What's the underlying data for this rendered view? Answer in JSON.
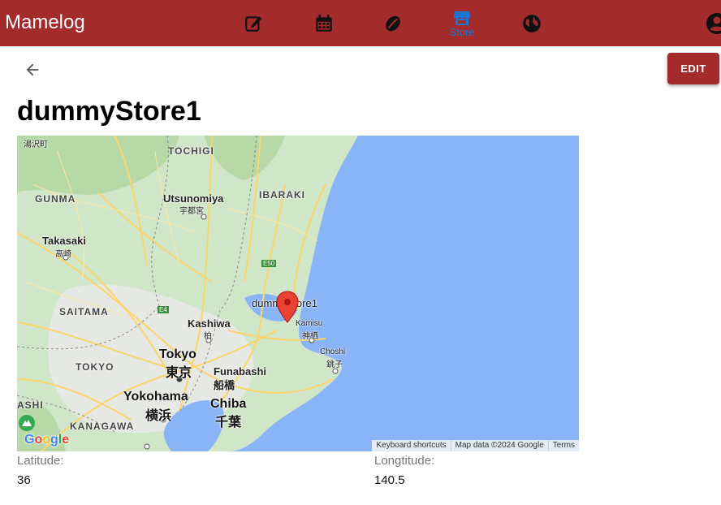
{
  "app": {
    "title": "Mamelog",
    "nav": [
      {
        "icon": "edit-note-icon",
        "label": ""
      },
      {
        "icon": "calendar-icon",
        "label": ""
      },
      {
        "icon": "coffee-bean-icon",
        "label": ""
      },
      {
        "icon": "store-icon",
        "label": "Store",
        "active": true
      },
      {
        "icon": "globe-icon",
        "label": ""
      }
    ],
    "account_icon": "account-circle-icon"
  },
  "toolbar": {
    "back_icon": "arrow-back-icon",
    "edit_label": "EDIT"
  },
  "store": {
    "name": "dummyStore1"
  },
  "map": {
    "marker_label": "dummyStore1",
    "places": {
      "yuzawa": "湯沢町",
      "tochigi": "TOCHIGI",
      "gunma": "GUNMA",
      "ibaraki": "IBARAKI",
      "utsunomiya": "Utsunomiya",
      "utsunomiya_jp": "宇都宮",
      "takasaki": "Takasaki",
      "takasaki_jp": "高崎",
      "e50": "E50",
      "saitama": "SAITAMA",
      "e4": "E4",
      "kashiwa": "Kashiwa",
      "kashiwa_jp": "柏",
      "kamisu": "Kamisu",
      "kamisu_jp": "神栖",
      "choshi": "Choshi",
      "choshi_jp": "銚子",
      "tokyo_region": "TOKYO",
      "tokyo": "Tokyo",
      "tokyo_jp": "東京",
      "funabashi": "Funabashi",
      "funabashi_jp": "船橋",
      "yokohama": "Yokohama",
      "yokohama_jp": "横浜",
      "chiba": "Chiba",
      "chiba_jp": "千葉",
      "kanagawa": "KANAGAWA",
      "ashi": "ASHI"
    },
    "attribution": {
      "shortcuts": "Keyboard shortcuts",
      "data": "Map data ©2024 Google",
      "terms": "Terms"
    },
    "logo": "Google",
    "colors": {
      "land": "#cfe6c8",
      "water": "#8ab4f8",
      "roads": "#fdd46b",
      "urban": "#e8eae6"
    }
  },
  "fields": {
    "latitude_label": "Latitude:",
    "latitude_value": "36",
    "longitude_label": "Longtitude:",
    "longitude_value": "140.5"
  },
  "colors": {
    "primary": "#a32b2b",
    "active_nav": "#1976d2"
  }
}
